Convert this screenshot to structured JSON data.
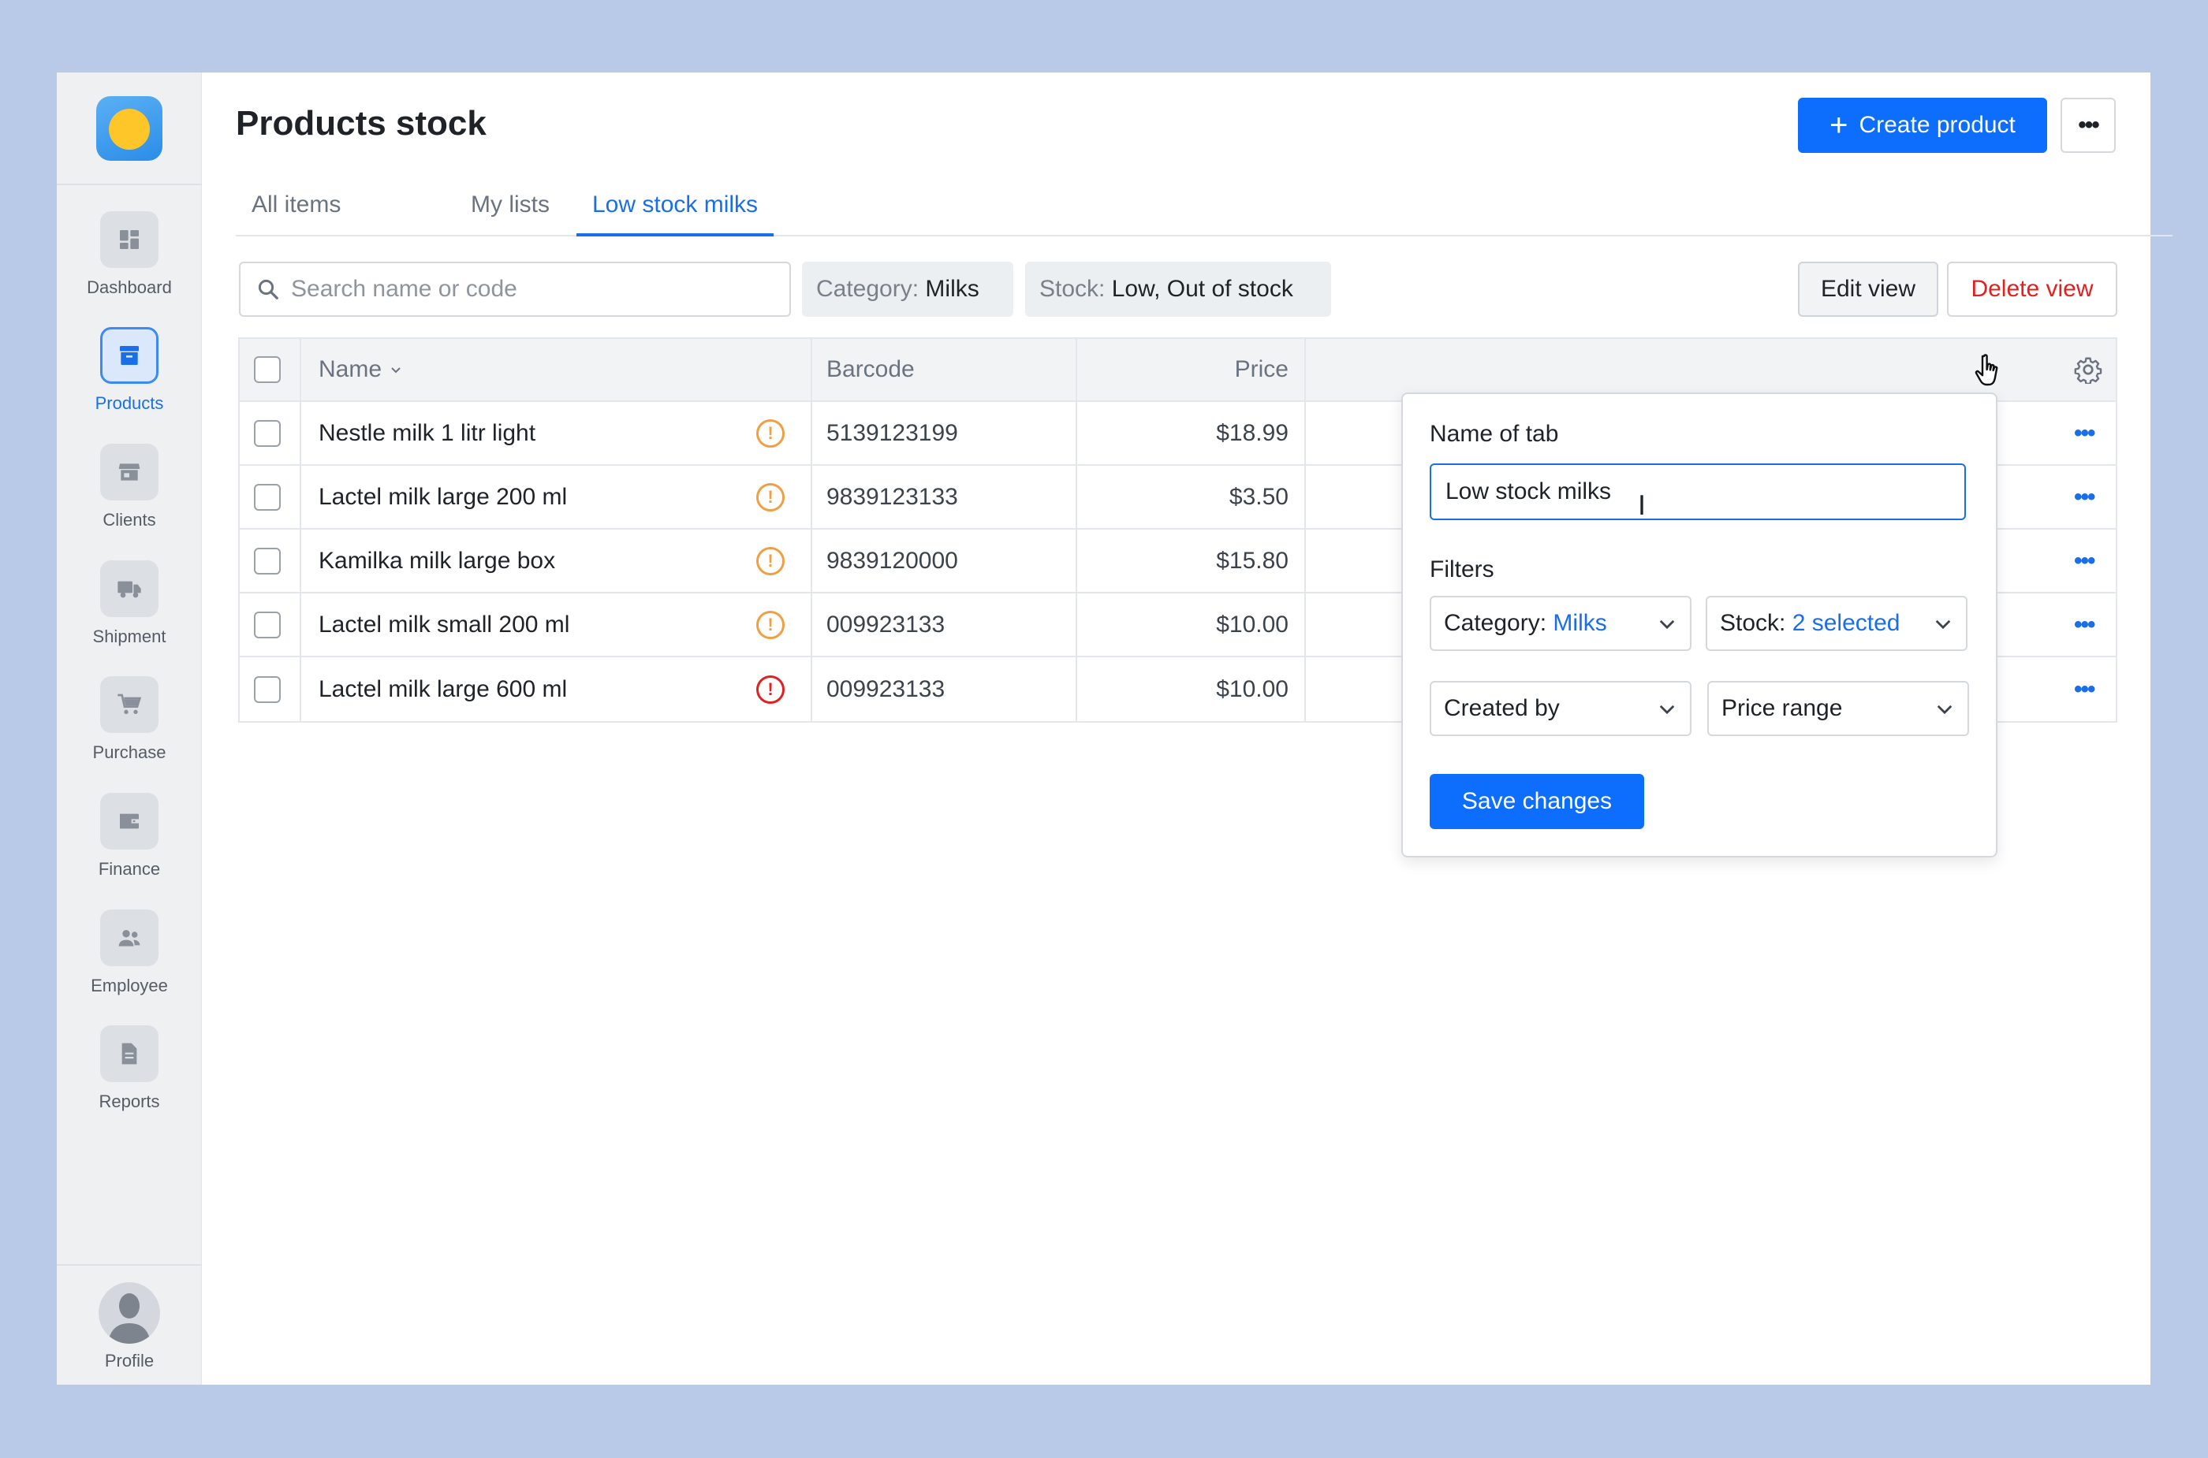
{
  "sidebar": {
    "items": [
      {
        "label": "Dashboard",
        "icon": "dashboard-icon"
      },
      {
        "label": "Products",
        "icon": "archive-box-icon",
        "active": true
      },
      {
        "label": "Clients",
        "icon": "store-icon"
      },
      {
        "label": "Shipment",
        "icon": "truck-icon"
      },
      {
        "label": "Purchase",
        "icon": "cart-icon"
      },
      {
        "label": "Finance",
        "icon": "wallet-icon"
      },
      {
        "label": "Employee",
        "icon": "users-icon"
      },
      {
        "label": "Reports",
        "icon": "document-icon"
      }
    ],
    "profile_label": "Profile"
  },
  "header": {
    "title": "Products stock",
    "create_label": "Create product",
    "more_label": "•••"
  },
  "tabs": [
    {
      "label": "All items"
    },
    {
      "label": "My lists"
    },
    {
      "label": "Low stock milks",
      "active": true
    }
  ],
  "filters": {
    "search_placeholder": "Search name or code",
    "category_key": "Category:",
    "category_value": "Milks",
    "stock_key": "Stock:",
    "stock_value": "Low, Out of stock",
    "edit_label": "Edit view",
    "delete_label": "Delete view"
  },
  "table": {
    "columns": {
      "name": "Name",
      "barcode": "Barcode",
      "price": "Price"
    },
    "rows": [
      {
        "name": "Nestle milk 1 litr light",
        "status": "low",
        "barcode": "5139123199",
        "price": "$18.99"
      },
      {
        "name": "Lactel milk large 200 ml",
        "status": "low",
        "barcode": "9839123133",
        "price": "$3.50"
      },
      {
        "name": "Kamilka milk large box",
        "status": "low",
        "barcode": "9839120000",
        "price": "$15.80"
      },
      {
        "name": "Lactel milk small 200 ml",
        "status": "low",
        "barcode": "009923133",
        "price": "$10.00"
      },
      {
        "name": "Lactel milk large 600 ml",
        "status": "out",
        "barcode": "009923133",
        "price": "$10.00"
      }
    ],
    "row_menu_label": "•••"
  },
  "popover": {
    "name_label": "Name of tab",
    "name_value": "Low stock milks",
    "filters_label": "Filters",
    "category_key": "Category:",
    "category_value": "Milks",
    "stock_key": "Stock:",
    "stock_value": "2 selected",
    "created_by": "Created by",
    "price_range": "Price range",
    "save_label": "Save changes"
  },
  "colors": {
    "accent": "#0d6efd",
    "danger": "#e0211f",
    "warning": "#f0a042",
    "background": "#b8cae8"
  }
}
